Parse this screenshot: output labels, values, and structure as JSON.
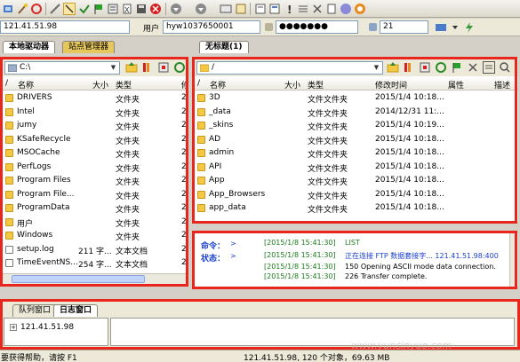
{
  "connection": {
    "host": "121.41.51.98",
    "user_label": "用户",
    "user": "hyw1037650001",
    "password_mask": "●●●●●●●",
    "port": "21"
  },
  "tabs": {
    "left": [
      "本地驱动器",
      "站点管理器"
    ],
    "right": [
      "无标题(1)"
    ]
  },
  "local": {
    "path": "C:\\",
    "columns": [
      "名称",
      "大小",
      "类型",
      "修"
    ],
    "files": [
      {
        "name": "DRIVERS",
        "size": "",
        "type": "文件夹",
        "kind": "folder"
      },
      {
        "name": "Intel",
        "size": "",
        "type": "文件夹",
        "kind": "folder"
      },
      {
        "name": "jumy",
        "size": "",
        "type": "文件夹",
        "kind": "folder"
      },
      {
        "name": "KSafeRecycle",
        "size": "",
        "type": "文件夹",
        "kind": "folder"
      },
      {
        "name": "MSOCache",
        "size": "",
        "type": "文件夹",
        "kind": "folder"
      },
      {
        "name": "PerfLogs",
        "size": "",
        "type": "文件夹",
        "kind": "folder"
      },
      {
        "name": "Program Files",
        "size": "",
        "type": "文件夹",
        "kind": "folder"
      },
      {
        "name": "Program File...",
        "size": "",
        "type": "文件夹",
        "kind": "folder"
      },
      {
        "name": "ProgramData",
        "size": "",
        "type": "文件夹",
        "kind": "folder"
      },
      {
        "name": "用户",
        "size": "",
        "type": "文件夹",
        "kind": "folder"
      },
      {
        "name": "Windows",
        "size": "",
        "type": "文件夹",
        "kind": "folder"
      },
      {
        "name": "setup.log",
        "size": "211 字...",
        "type": "文本文档",
        "kind": "file"
      },
      {
        "name": "TimeEventNS...",
        "size": "254 字...",
        "type": "文本文档",
        "kind": "file"
      }
    ],
    "date_col_peek": [
      "2",
      "2",
      "2",
      "2",
      "2",
      "2",
      "2",
      "2",
      "2",
      "2",
      "2",
      "2",
      "2"
    ]
  },
  "remote": {
    "path": "/",
    "columns": [
      "名称",
      "大小",
      "类型",
      "修改时间",
      "属性",
      "描述"
    ],
    "files": [
      {
        "name": "3D",
        "type": "文件文件夹",
        "date": "2015/1/4 10:18..."
      },
      {
        "name": "_data",
        "type": "文件文件夹",
        "date": "2014/12/31 11:..."
      },
      {
        "name": "_skins",
        "type": "文件文件夹",
        "date": "2015/1/4 10:19..."
      },
      {
        "name": "AD",
        "type": "文件文件夹",
        "date": "2015/1/4 10:18..."
      },
      {
        "name": "admin",
        "type": "文件文件夹",
        "date": "2015/1/4 10:18..."
      },
      {
        "name": "API",
        "type": "文件文件夹",
        "date": "2015/1/4 10:18..."
      },
      {
        "name": "App",
        "type": "文件文件夹",
        "date": "2015/1/4 10:18..."
      },
      {
        "name": "App_Browsers",
        "type": "文件文件夹",
        "date": "2015/1/4 10:18..."
      },
      {
        "name": "app_data",
        "type": "文件文件夹",
        "date": "2015/1/4 10:18..."
      }
    ]
  },
  "log": {
    "cmd_label": "命令：",
    "status_label": "状态：",
    "arrow": ">",
    "lines": [
      {
        "ts": "[2015/1/8 15:41:30]",
        "text": "LIST",
        "color": "#1a7a1a"
      },
      {
        "ts": "[2015/1/8 15:41:30]",
        "text": "正在连接 FTP 数据套接字... 121.41.51.98:400",
        "color": "#1a3fd0"
      },
      {
        "ts": "[2015/1/8 15:41:30]",
        "text": "150 Opening ASCII mode data connection.",
        "color": "#000000"
      },
      {
        "ts": "[2015/1/8 15:41:30]",
        "text": "226 Transfer complete.",
        "color": "#000000"
      }
    ]
  },
  "bottom": {
    "tabs": [
      "队列窗口",
      "日志窗口"
    ],
    "tree_item": "121.41.51.98"
  },
  "status": {
    "help": "要获得帮助，请按 F1",
    "summary": "121.41.51.98, 120 个对象，69.63 MB"
  },
  "watermark": "www.yunsinyuo.com"
}
